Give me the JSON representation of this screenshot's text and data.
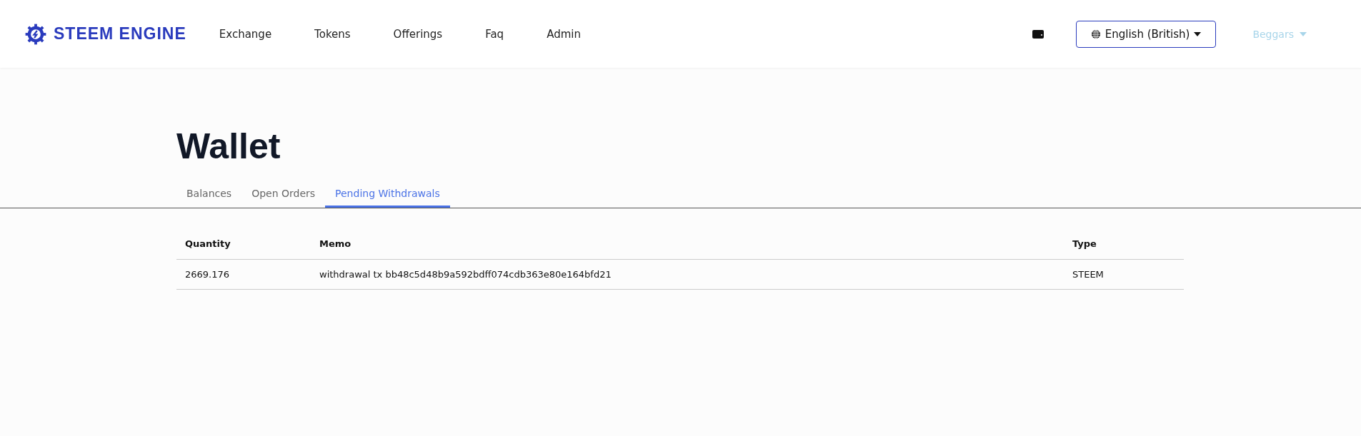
{
  "header": {
    "brand": "STEEM ENGINE",
    "nav": [
      {
        "label": "Exchange"
      },
      {
        "label": "Tokens"
      },
      {
        "label": "Offerings"
      },
      {
        "label": "Faq"
      },
      {
        "label": "Admin"
      }
    ],
    "language": "English (British)",
    "user": "Beggars"
  },
  "page": {
    "title": "Wallet"
  },
  "tabs": [
    {
      "label": "Balances",
      "selected": false
    },
    {
      "label": "Open Orders",
      "selected": false
    },
    {
      "label": "Pending Withdrawals",
      "selected": true
    }
  ],
  "table": {
    "columns": [
      "Quantity",
      "Memo",
      "Type"
    ],
    "rows": [
      [
        "2669.176",
        "withdrawal tx bb48c5d48b9a592bdff074cdb363e80e164bfd21",
        "STEEM"
      ]
    ]
  }
}
